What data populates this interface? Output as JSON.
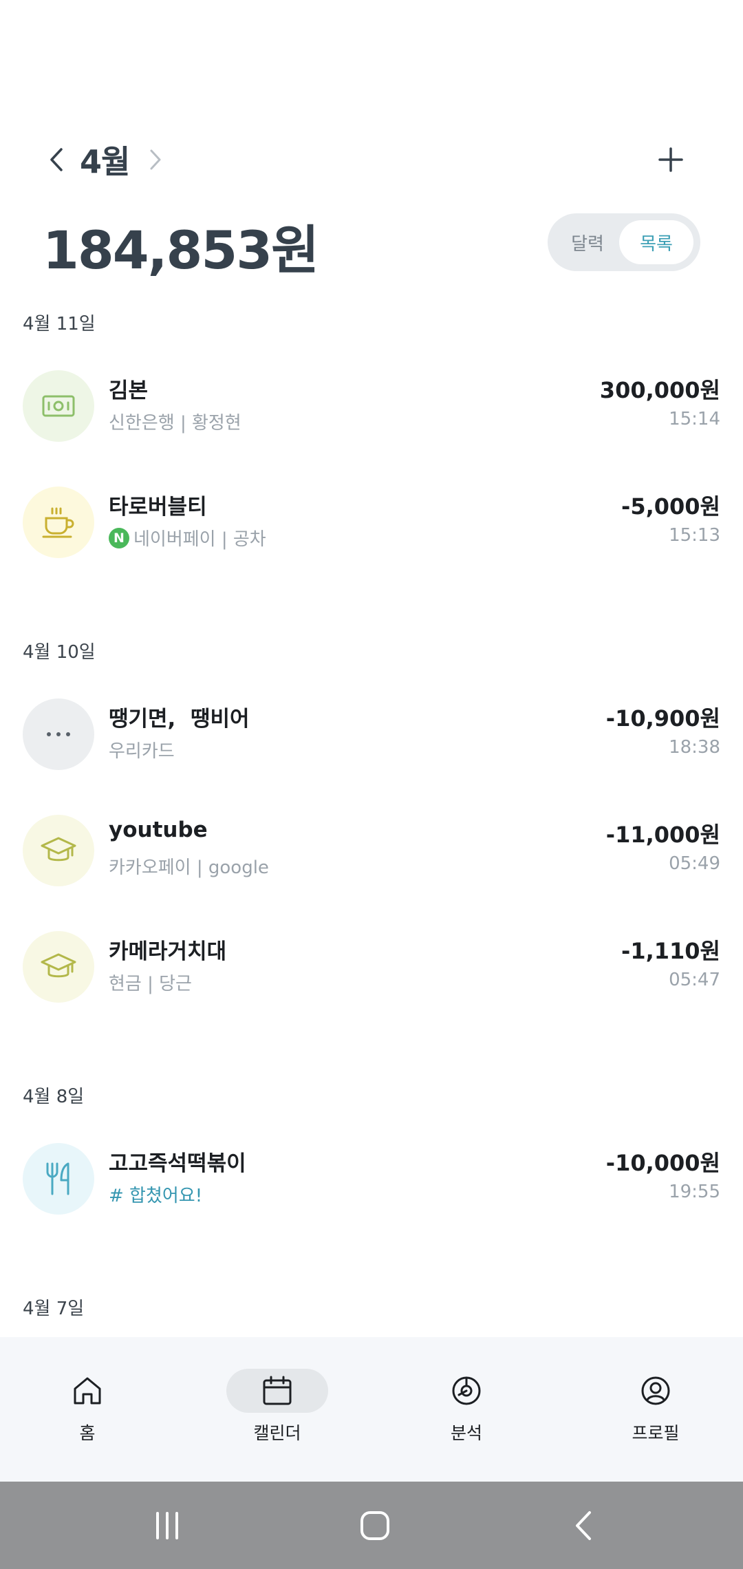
{
  "header": {
    "month": "4월",
    "total": "184,853원",
    "toggle": {
      "calendar": "달력",
      "list": "목록",
      "selected": "목록"
    }
  },
  "groups": [
    {
      "date": "4월 11일",
      "items": [
        {
          "name": "김본",
          "sub": "신한은행 | 황정현",
          "amount": "300,000원",
          "time": "15:14",
          "icon": "money-bill-icon",
          "icon_bg": "#eef6e6",
          "icon_color": "#8dbf6a"
        },
        {
          "name": "타로버블티",
          "sub": "네이버페이 | 공차",
          "badge": "N",
          "amount": "-5,000원",
          "time": "15:13",
          "icon": "coffee-cup-icon",
          "icon_bg": "#fdf9dd",
          "icon_color": "#c9b030"
        }
      ]
    },
    {
      "date": "4월 10일",
      "items": [
        {
          "name": "땡기면,  땡비어",
          "sub": "우리카드",
          "amount": "-10,900원",
          "time": "18:38",
          "icon": "more-dots-icon",
          "icon_bg": "#eceef0",
          "icon_color": "#59616a"
        },
        {
          "name": "youtube",
          "sub": "카카오페이 | google",
          "amount": "-11,000원",
          "time": "05:49",
          "icon": "graduation-cap-icon",
          "icon_bg": "#f8f8e4",
          "icon_color": "#b3b84a"
        },
        {
          "name": "카메라거치대",
          "sub": "현금 | 당근",
          "amount": "-1,110원",
          "time": "05:47",
          "icon": "graduation-cap-icon",
          "icon_bg": "#f8f8e4",
          "icon_color": "#b3b84a"
        }
      ]
    },
    {
      "date": "4월 8일",
      "items": [
        {
          "name": "고고즉석떡볶이",
          "sub": "# 합쳤어요!",
          "amount": "-10,000원",
          "time": "19:55",
          "icon": "fork-knife-icon",
          "icon_bg": "#e8f6fa",
          "icon_color": "#4aa9c2",
          "tag": true
        }
      ]
    },
    {
      "date": "4월 7일",
      "items": []
    }
  ],
  "bottom_nav": [
    {
      "label": "홈",
      "icon": "home-icon"
    },
    {
      "label": "캘린더",
      "icon": "calendar-icon",
      "active": true
    },
    {
      "label": "분석",
      "icon": "pie-chart-icon"
    },
    {
      "label": "프로필",
      "icon": "user-circle-icon"
    }
  ],
  "system_nav": [
    "recent-apps-icon",
    "home-button-icon",
    "back-icon"
  ],
  "colors": {
    "accent": "#3c9fb5",
    "title": "#36414c",
    "muted": "#9aa2aa"
  }
}
